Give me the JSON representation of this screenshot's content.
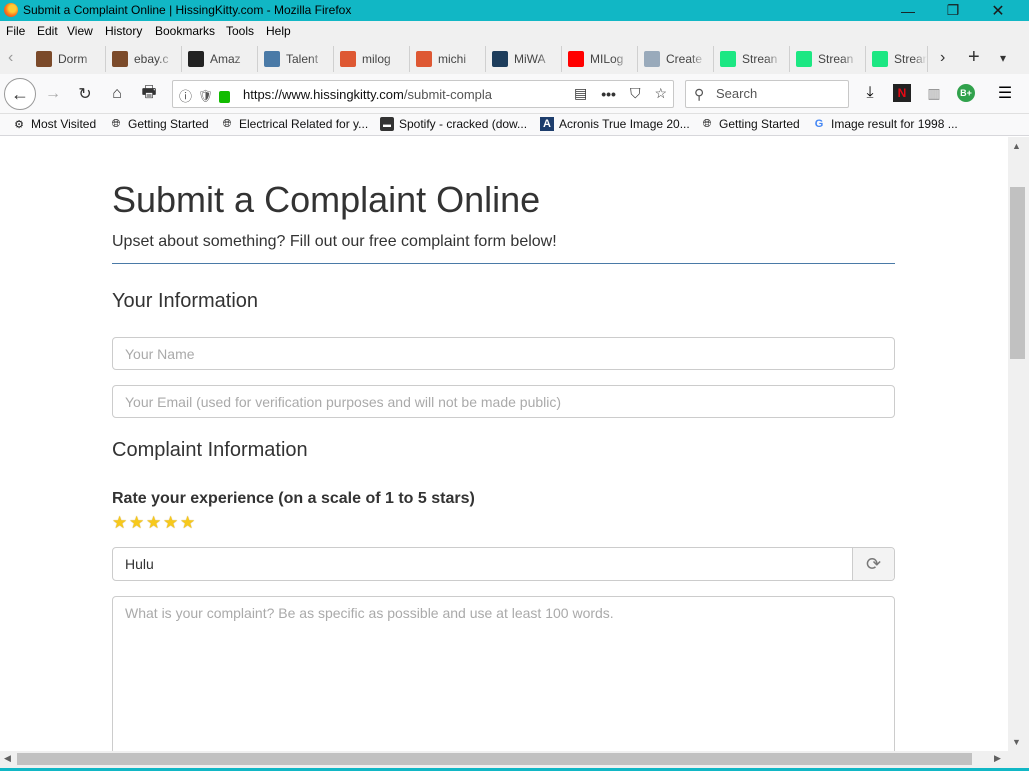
{
  "window": {
    "title": "Submit a Complaint Online | HissingKitty.com - Mozilla Firefox",
    "controls": {
      "minimize": "—",
      "maximize": "❐",
      "close": "✕"
    },
    "frame_color": "#11b7c5"
  },
  "menubar": {
    "items": [
      "File",
      "Edit",
      "View",
      "History",
      "Bookmarks",
      "Tools",
      "Help"
    ]
  },
  "tabs": [
    {
      "label": "Dorm",
      "icon": "shopping-bag-icon",
      "color": "#7b4a2a"
    },
    {
      "label": "ebay.c",
      "icon": "shopping-bag-icon",
      "color": "#7b4a2a"
    },
    {
      "label": "Amaz",
      "icon": "amazon-icon",
      "color": "#222222"
    },
    {
      "label": "Talent",
      "icon": "talent-icon",
      "color": "#4a7aa7"
    },
    {
      "label": "milog",
      "icon": "duckduckgo-icon",
      "color": "#de5833"
    },
    {
      "label": "michi",
      "icon": "duckduckgo-icon",
      "color": "#de5833"
    },
    {
      "label": "MiWA",
      "icon": "miwam-icon",
      "color": "#1d3d5c"
    },
    {
      "label": "MILog",
      "icon": "youtube-icon",
      "color": "#ff0000"
    },
    {
      "label": "Create",
      "icon": "create-icon",
      "color": "#9ab"
    },
    {
      "label": "Strean",
      "icon": "hulu-icon",
      "color": "#1ce783"
    },
    {
      "label": "Strean",
      "icon": "hulu-icon",
      "color": "#1ce783"
    },
    {
      "label": "Strean",
      "icon": "hulu-icon",
      "color": "#1ce783"
    }
  ],
  "navbar": {
    "url_host": "https://www.hissingkitty.com",
    "url_path": "/submit-compla",
    "search_placeholder": "Search"
  },
  "bookmarks": [
    {
      "label": "Most Visited",
      "icon": "gear-icon"
    },
    {
      "label": "Getting Started",
      "icon": "globe-icon"
    },
    {
      "label": "Electrical Related for y...",
      "icon": "globe-icon"
    },
    {
      "label": "Spotify - cracked (dow...",
      "icon": "chair-icon"
    },
    {
      "label": "Acronis True Image 20...",
      "icon": "acronis-icon"
    },
    {
      "label": "Getting Started",
      "icon": "globe-icon"
    },
    {
      "label": "Image result for 1998 ...",
      "icon": "google-icon"
    }
  ],
  "page": {
    "heading": "Submit a Complaint Online",
    "subtitle": "Upset about something? Fill out our free complaint form below!",
    "section_your_info": "Your Information",
    "name_placeholder": "Your Name",
    "email_placeholder": "Your Email (used for verification purposes and will not be made public)",
    "section_complaint": "Complaint Information",
    "rating_label": "Rate your experience (on a scale of 1 to 5 stars)",
    "rating": 5,
    "rating_max": 5,
    "company_value": "Hulu",
    "complaint_placeholder": "What is your complaint? Be as specific as possible and use at least 100 words."
  }
}
